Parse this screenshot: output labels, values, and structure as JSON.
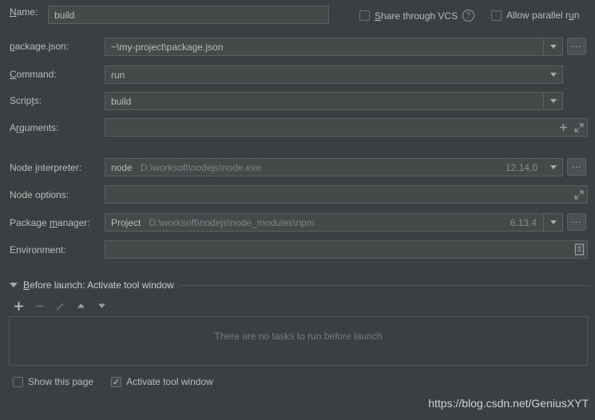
{
  "form": {
    "name": {
      "label": "Name:",
      "mnemonic": "N",
      "value": "build"
    },
    "share_vcs": {
      "label_before": "S",
      "label_mnemonic": "S",
      "label": "Share through VCS",
      "checked": false,
      "help_icon": "?"
    },
    "allow_parallel": {
      "label": "Allow parallel run",
      "checked": false
    },
    "package_json": {
      "label": "package.json:",
      "value": "~\\my-project\\package.json",
      "browse_label": "..."
    },
    "command": {
      "label": "Command:",
      "value": "run"
    },
    "scripts": {
      "label": "Scripts:",
      "value": "build"
    },
    "arguments": {
      "label": "Arguments:",
      "value": "",
      "add_icon": "+",
      "expand_icon": "expand"
    },
    "node_interpreter": {
      "label": "Node interpreter:",
      "value": "node",
      "path": "D:\\worksoft\\nodejs\\node.exe",
      "version": "12.14.0",
      "browse_label": "..."
    },
    "node_options": {
      "label": "Node options:",
      "value": ""
    },
    "package_manager": {
      "label": "Package manager:",
      "value": "Project",
      "path": "D:\\worksoft\\nodejs\\node_modules\\npm",
      "version": "6.13.4",
      "browse_label": "..."
    },
    "environment": {
      "label": "Environment:",
      "value": ""
    }
  },
  "before_launch": {
    "title": "Before launch: Activate tool window",
    "toolbar": {
      "add": "+",
      "remove": "−",
      "edit": "edit-pencil",
      "move_up": "move-up",
      "move_down": "move-down"
    },
    "empty_message": "There are no tasks to run before launch",
    "show_this_page": {
      "label": "Show this page",
      "checked": false
    },
    "activate_tool_window": {
      "label": "Activate tool window",
      "checked": true,
      "mark": "✓"
    }
  },
  "watermark": {
    "text": "https://blog.csdn.net/GeniusXYT"
  },
  "colors": {
    "background": "#3c3f41",
    "field_background": "#45494a",
    "field_border": "#5e6060",
    "text": "#bbbbbb",
    "hint_text": "#808385",
    "separator": "#555859"
  }
}
